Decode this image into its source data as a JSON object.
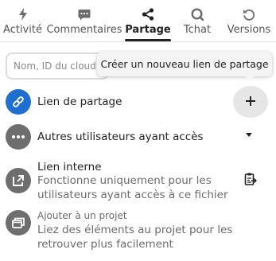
{
  "tabs": [
    {
      "label": "Activité",
      "icon": "lightning-icon"
    },
    {
      "label": "Commentaires",
      "icon": "comment-icon"
    },
    {
      "label": "Partage",
      "icon": "share-icon",
      "active": true
    },
    {
      "label": "Tchat",
      "icon": "chat-icon"
    },
    {
      "label": "Versions",
      "icon": "history-icon"
    }
  ],
  "search": {
    "placeholder": "Nom, ID du cloud fédéré ou adresse e-mail…"
  },
  "tooltip": {
    "text": "Créer un nouveau lien de partage"
  },
  "share_link": {
    "title": "Lien de partage",
    "icon": "link-icon",
    "add_icon": "plus-icon"
  },
  "other_users": {
    "title": "Autres utilisateurs ayant accès",
    "icon": "dots-icon"
  },
  "internal_link": {
    "title": "Lien interne",
    "subtitle": "Fonctionne uniquement pour les utilisateurs ayant accès à ce fichier",
    "icon": "external-link-icon",
    "copy_icon": "clipboard-icon"
  },
  "project": {
    "title": "Ajouter à un projet",
    "subtitle": "Liez des éléments au projet pour les retrouver plus facilement",
    "icon": "project-icon"
  },
  "colors": {
    "accent": "#1f6fd1",
    "avatar_grey": "#6e6e6e"
  }
}
